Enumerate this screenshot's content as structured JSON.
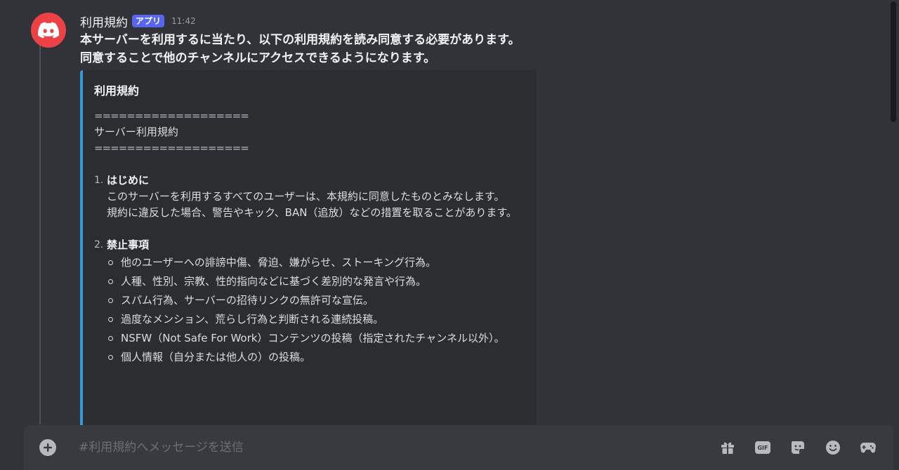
{
  "message": {
    "author": "利用規約",
    "badge": "アプリ",
    "time": "11:42",
    "lines": [
      "本サーバーを利用するに当たり、以下の利用規約を読み同意する必要があります。",
      "同意することで他のチャンネルにアクセスできるようになります。"
    ]
  },
  "embed": {
    "title": "利用規約",
    "separator": "===================",
    "heading": "サーバー利用規約",
    "sections": [
      {
        "number": "1.",
        "title": "はじめに",
        "paragraphs": [
          "このサーバーを利用するすべてのユーザーは、本規約に同意したものとみなします。",
          "規約に違反した場合、警告やキック、BAN（追放）などの措置を取ることがあります。"
        ]
      },
      {
        "number": "2.",
        "title": "禁止事項",
        "bullets": [
          "他のユーザーへの誹謗中傷、脅迫、嫌がらせ、ストーキング行為。",
          "人種、性別、宗教、性的指向などに基づく差別的な発言や行為。",
          "スパム行為、サーバーの招待リンクの無許可な宣伝。",
          "過度なメンション、荒らし行為と判断される連続投稿。",
          "NSFW（Not Safe For Work）コンテンツの投稿（指定されたチャンネル以外）。",
          "個人情報（自分または他人の）の投稿。"
        ]
      }
    ],
    "accent_color": "#3498db"
  },
  "composer": {
    "placeholder": "#利用規約へメッセージを送信"
  },
  "icons": {
    "avatar": "discord-logo-icon",
    "attach": "plus-circle-icon",
    "gift": "gift-icon",
    "gif": "gif-icon",
    "sticker": "sticker-icon",
    "emoji": "emoji-icon",
    "activities": "gamepad-icon"
  },
  "colors": {
    "avatar_bg": "#ed4245",
    "badge_bg": "#5865f2",
    "background": "#313338"
  }
}
